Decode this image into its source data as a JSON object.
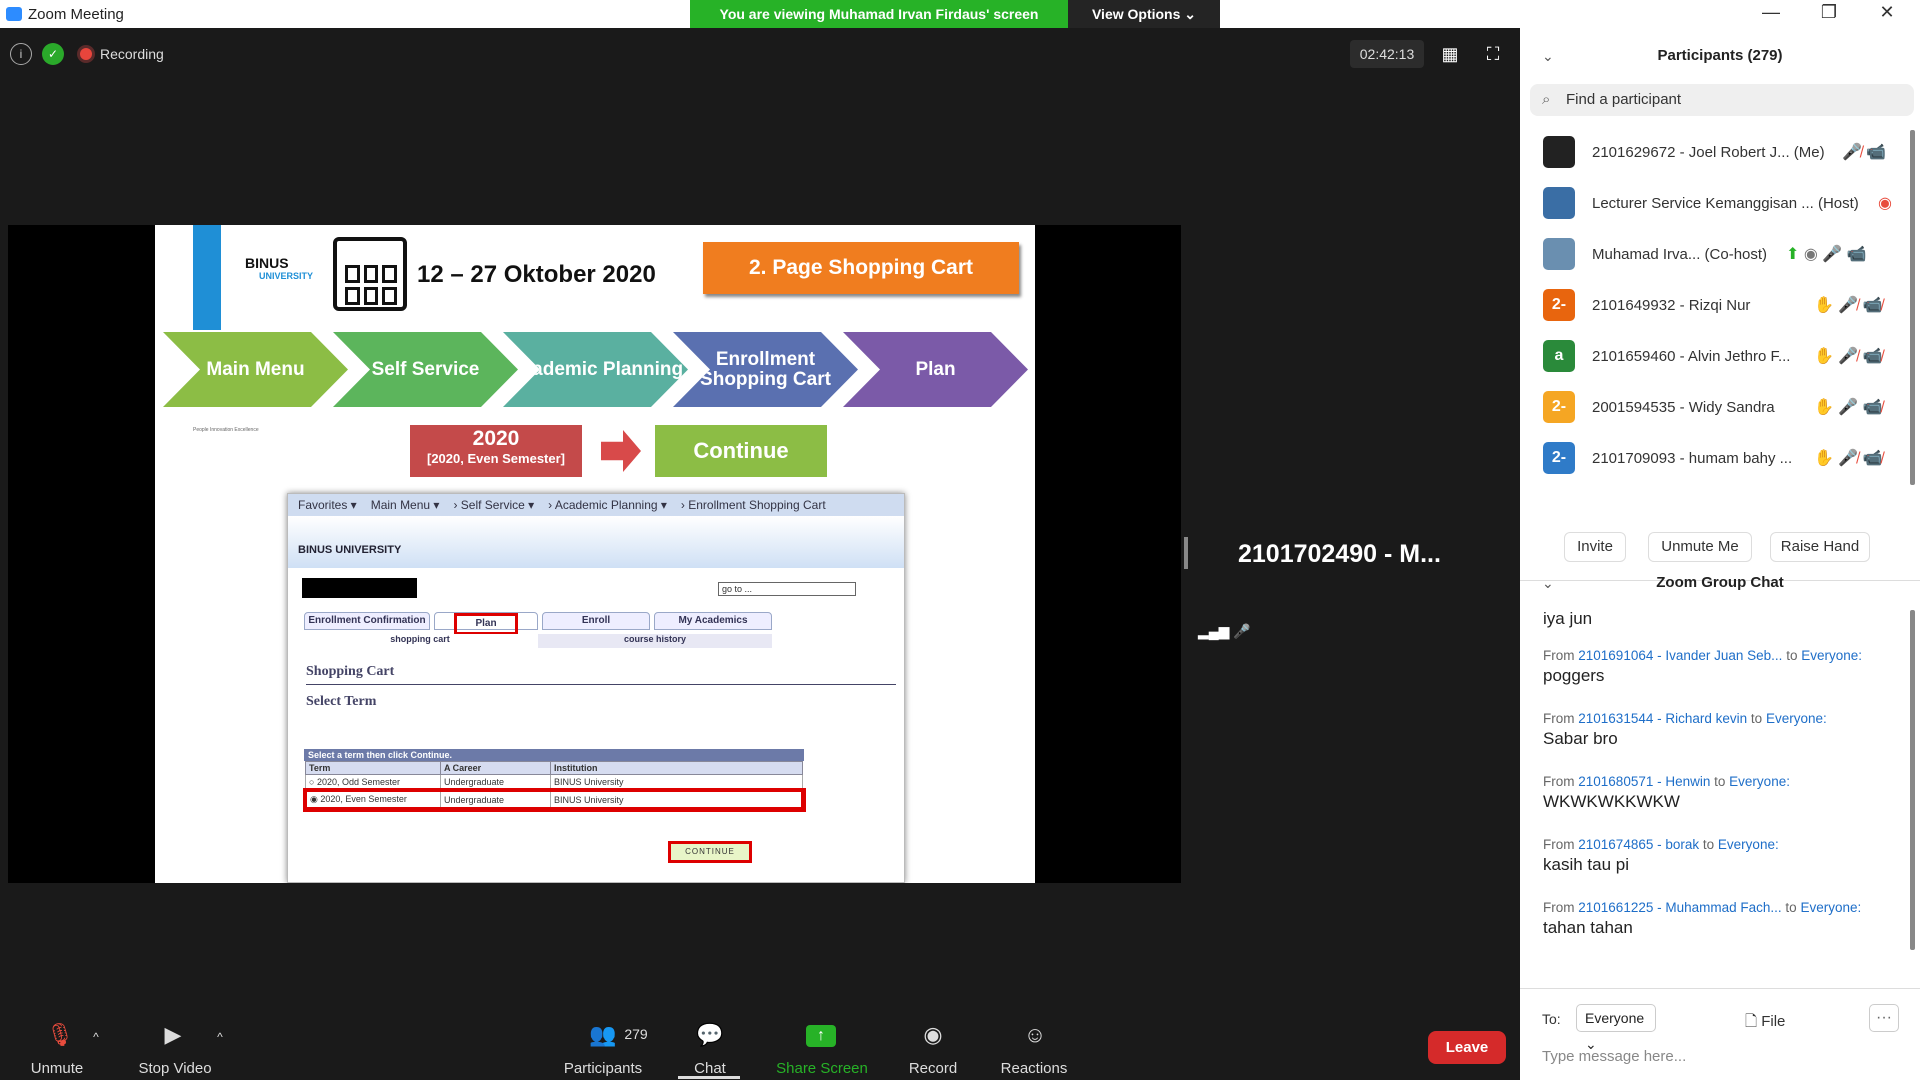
{
  "window": {
    "title": "Zoom Meeting",
    "banner": "You are viewing Muhamad Irvan Firdaus' screen",
    "view_options": "View Options ⌄",
    "min": "—",
    "max": "❐",
    "close": "✕"
  },
  "topbar": {
    "recording": "Recording",
    "timer": "02:42:13"
  },
  "slide": {
    "logo": "BINUS",
    "logo_sub": "UNIVERSITY",
    "date_range": "12 – 27 Oktober 2020",
    "page_badge": "2. Page Shopping Cart",
    "steps": [
      "Main Menu",
      "Self Service",
      "Academic Planning",
      "Enrollment Shopping Cart",
      "Plan"
    ],
    "tagline": "People Innovation Excellence",
    "year": "2020",
    "term": "[2020, Even Semester]",
    "continue": "Continue",
    "ps": {
      "nav": [
        "Favorites ▾",
        "Main Menu ▾",
        "› Self Service ▾",
        "› Academic Planning ▾",
        "› Enrollment Shopping Cart"
      ],
      "logo": "BINUS UNIVERSITY",
      "goto": "go to ...",
      "tabs": [
        "Enrollment Confirmation",
        "Plan",
        "Enroll",
        "My Academics"
      ],
      "subs": [
        "shopping cart",
        "course history"
      ],
      "title": "Shopping Cart",
      "subtitle": "Select Term",
      "caption": "Select a term then click Continue.",
      "headers": [
        "Term",
        "A Career",
        "Institution"
      ],
      "rows": [
        [
          "2020, Odd Semester",
          "Undergraduate",
          "BINUS University"
        ],
        [
          "2020, Even Semester",
          "Undergraduate",
          "BINUS University"
        ]
      ],
      "continue": "CONTINUE"
    }
  },
  "speaker": {
    "name": "2101702490 - M..."
  },
  "toolbar": {
    "unmute": "Unmute",
    "stop_video": "Stop Video",
    "participants": "Participants",
    "participant_count": "279",
    "chat": "Chat",
    "share": "Share Screen",
    "record": "Record",
    "reactions": "Reactions",
    "leave": "Leave"
  },
  "participants": {
    "title": "Participants (279)",
    "search_placeholder": "Find a participant",
    "list": [
      {
        "name": "2101629672 - Joel Robert J... (Me)",
        "avatar": "",
        "color": "#222"
      },
      {
        "name": "Lecturer Service Kemanggisan ... (Host)",
        "avatar": "",
        "color": "#3a6ea5"
      },
      {
        "name": "Muhamad Irva... (Co-host)",
        "avatar": "",
        "color": "#6a8fb0"
      },
      {
        "name": "2101649932 - Rizqi Nur",
        "avatar": "2-",
        "color": "#e8650e"
      },
      {
        "name": "2101659460 - Alvin Jethro F...",
        "avatar": "a",
        "color": "#2a8a3a"
      },
      {
        "name": "2001594535 - Widy Sandra",
        "avatar": "2-",
        "color": "#f5a623"
      },
      {
        "name": "2101709093 - humam bahy ...",
        "avatar": "2-",
        "color": "#2f7bc8"
      }
    ],
    "buttons": [
      "Invite",
      "Unmute Me",
      "Raise Hand"
    ]
  },
  "chat": {
    "title": "Zoom Group Chat",
    "first": "iya jun",
    "from": "From",
    "to_word": "to",
    "everyone": "Everyone:",
    "messages": [
      {
        "sender": "2101691064 - Ivander Juan Seb...",
        "text": "poggers"
      },
      {
        "sender": "2101631544 - Richard kevin",
        "text": "Sabar bro"
      },
      {
        "sender": "2101680571 - Henwin",
        "text": "WKWKWKKWKW"
      },
      {
        "sender": "2101674865 - borak",
        "text": "kasih tau pi"
      },
      {
        "sender": "2101661225 - Muhammad Fach...",
        "text": "tahan tahan"
      }
    ],
    "to_label": "To:",
    "recipient": "Everyone ⌄",
    "file": "File",
    "more": "···",
    "placeholder": "Type message here..."
  }
}
